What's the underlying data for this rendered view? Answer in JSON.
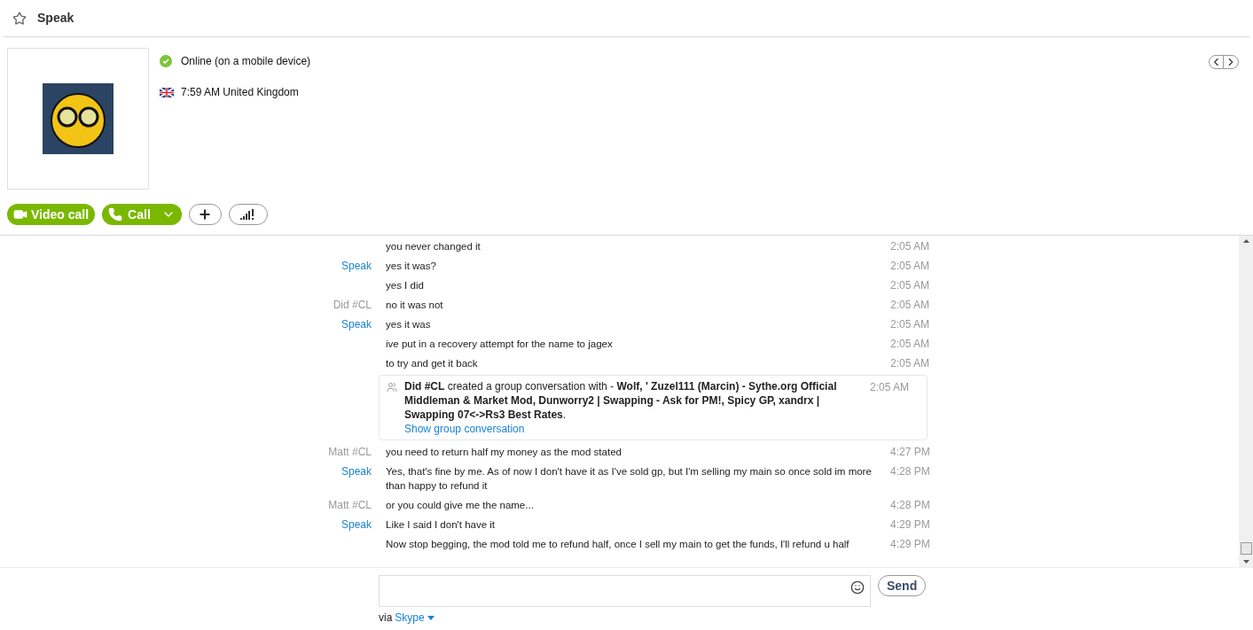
{
  "header": {
    "title": "Speak"
  },
  "profile": {
    "status": "Online (on a mobile device)",
    "local_time": "7:59 AM United Kingdom"
  },
  "actions": {
    "video_call": "Video call",
    "call": "Call"
  },
  "messages": [
    {
      "kind": "message",
      "text": "you never changed it",
      "time": "2:05 AM"
    },
    {
      "kind": "message",
      "sender": "Speak",
      "color": "#1a83d4",
      "text": "yes it was?",
      "time": "2:05 AM"
    },
    {
      "kind": "message",
      "text": "yes I did",
      "time": "2:05 AM"
    },
    {
      "kind": "message",
      "sender": "Did #CL",
      "color": "#999999",
      "text": "no it was not",
      "time": "2:05 AM"
    },
    {
      "kind": "message",
      "sender": "Speak",
      "color": "#1a83d4",
      "text": "yes it was",
      "time": "2:05 AM"
    },
    {
      "kind": "message",
      "text": "ive put in a recovery attempt for the name to jagex",
      "time": "2:05 AM"
    },
    {
      "kind": "message",
      "text": "to try and get it back",
      "time": "2:05 AM"
    },
    {
      "kind": "event",
      "text": "**Did #CL** created a group conversation with - **Wolf, ' Zuzel111 (Marcin) - Sythe.org Official Middleman & Market Mod, Dunworry2 | Swapping - Ask for PM!, Spicy GP, xandrx | Swapping 07<->Rs3 Best Rates**.",
      "link": "Show group conversation",
      "time": "2:05 AM"
    },
    {
      "kind": "message",
      "sender": "Matt #CL",
      "color": "#999999",
      "text": "you need to return half my money as the mod stated",
      "time": "4:27 PM"
    },
    {
      "kind": "message",
      "sender": "Speak",
      "color": "#1a83d4",
      "text": "Yes, that's fine by me. As of now I don't have it as I've sold gp, but I'm selling my main so once sold im more than happy to refund it",
      "time": "4:28 PM"
    },
    {
      "kind": "message",
      "sender": "Matt #CL",
      "color": "#999999",
      "text": "or you could give me the name...",
      "time": "4:28 PM"
    },
    {
      "kind": "message",
      "sender": "Speak",
      "color": "#1a83d4",
      "text": "Like I said I don't have it",
      "time": "4:29 PM"
    },
    {
      "kind": "message",
      "text": "Now stop begging, the mod told me to refund half, once I sell my main to get the funds, I'll refund u half",
      "time": "4:29 PM"
    }
  ],
  "composer": {
    "send": "Send",
    "via": "via",
    "service": "Skype"
  }
}
